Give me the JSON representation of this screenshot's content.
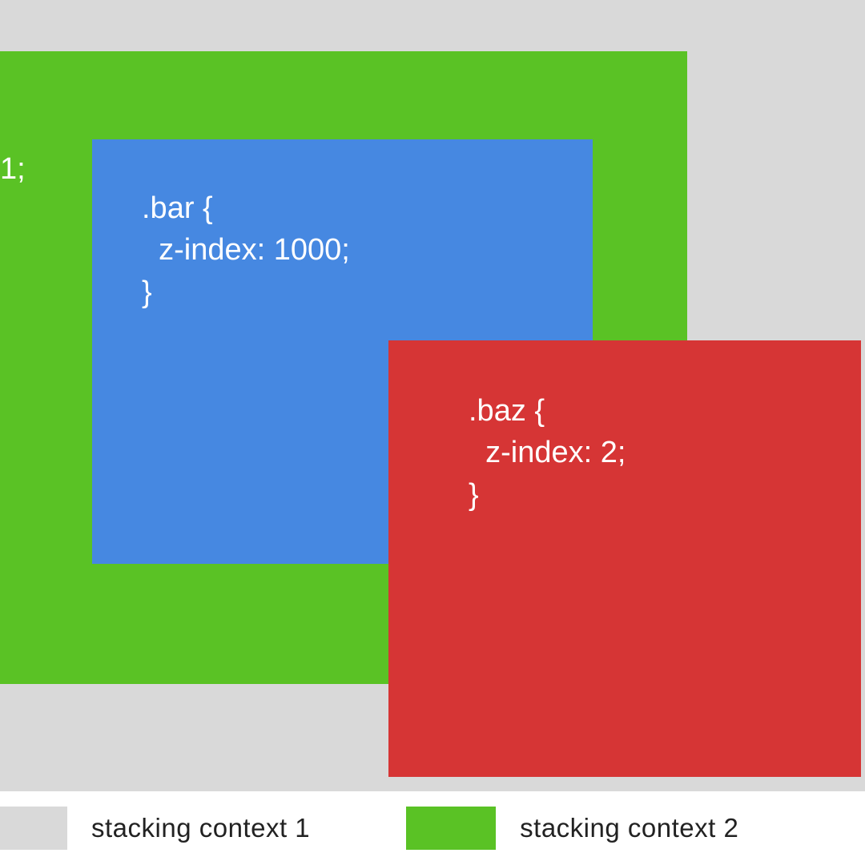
{
  "boxes": {
    "foo": {
      "text": "1;",
      "color": "#5ac225"
    },
    "bar": {
      "text": ".bar {\n  z-index: 1000;\n}",
      "color": "#4688e1"
    },
    "baz": {
      "text": ".baz {\n  z-index: 2;\n}",
      "color": "#d63535"
    }
  },
  "legend": {
    "item1": {
      "label": "stacking context 1",
      "color": "#d9d9d9"
    },
    "item2": {
      "label": "stacking context 2",
      "color": "#5ac225"
    }
  }
}
